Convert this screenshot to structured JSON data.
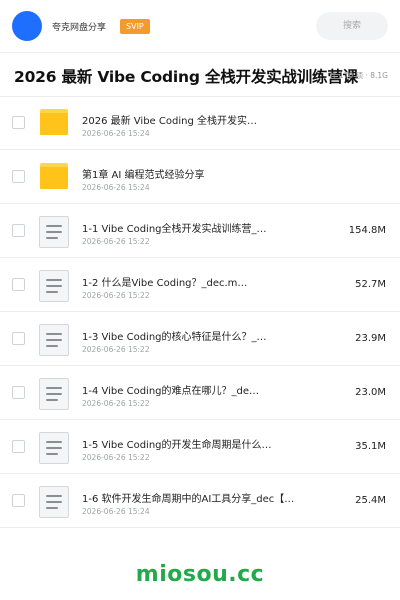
{
  "header": {
    "site_name": "夸克网盘分享",
    "badge": "SVIP",
    "search_placeholder": "搜索"
  },
  "share": {
    "title": "2026 最新 Vibe Coding 全栈开发实战训练营课",
    "meta": "共 170 项 · 8.1G"
  },
  "files": [
    {
      "type": "folder",
      "name": "2026 最新 Vibe Coding 全栈开发实…",
      "date": "2026-06-26 15:24",
      "size": ""
    },
    {
      "type": "folder",
      "name": "第1章 AI 编程范式经验分享",
      "date": "2026-06-26 15:24",
      "size": ""
    },
    {
      "type": "file",
      "name": "1-1 Vibe Coding全栈开发实战训练营_…",
      "date": "2026-06-26 15:22",
      "size": "154.8M"
    },
    {
      "type": "file",
      "name": "1-2 什么是Vibe Coding？_dec.m…",
      "date": "2026-06-26 15:22",
      "size": "52.7M"
    },
    {
      "type": "file",
      "name": "1-3 Vibe Coding的核心特征是什么？_…",
      "date": "2026-06-26 15:22",
      "size": "23.9M"
    },
    {
      "type": "file",
      "name": "1-4 Vibe Coding的难点在哪儿？_de…",
      "date": "2026-06-26 15:22",
      "size": "23.0M"
    },
    {
      "type": "file",
      "name": "1-5 Vibe Coding的开发生命周期是什么…",
      "date": "2026-06-26 15:22",
      "size": "35.1M"
    },
    {
      "type": "file",
      "name": "1-6 软件开发生命周期中的AI工具分享_dec【…",
      "date": "2026-06-26 15:24",
      "size": "25.4M"
    }
  ],
  "footer": {
    "watermark": "miosou.cc"
  },
  "colors": {
    "avatar": "#1f6fff",
    "badge": "#f39c2b",
    "folder": "#ffc31a",
    "watermark": "#22aa4a"
  },
  "icons": {
    "folder": "folder-icon",
    "file": "document-icon"
  }
}
